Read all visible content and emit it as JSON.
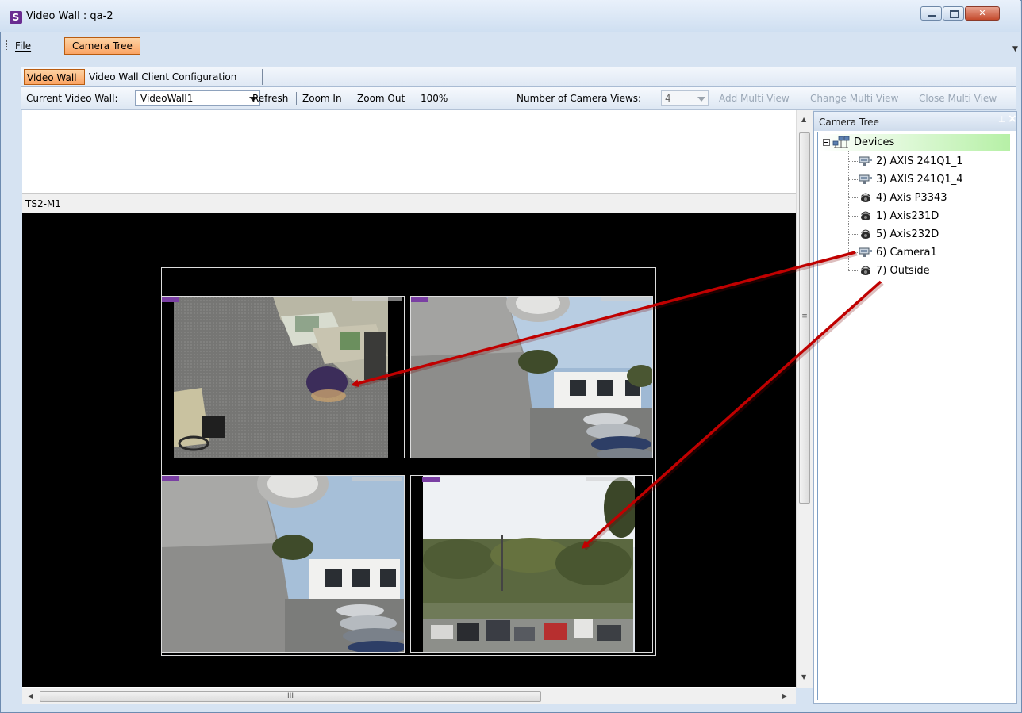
{
  "window": {
    "title": "Video Wall : qa-2",
    "app_icon_letter": "S"
  },
  "menu": {
    "file": "File",
    "camera_tree": "Camera Tree"
  },
  "tabs": [
    {
      "label": "Video Wall",
      "active": true
    },
    {
      "label": "Video Wall Client Configuration",
      "active": false
    }
  ],
  "toolbar": {
    "current_wall_label": "Current Video Wall:",
    "current_wall_value": "VideoWall1",
    "refresh": "Refresh",
    "zoom_in": "Zoom In",
    "zoom_out": "Zoom Out",
    "zoom_level": "100%",
    "num_views_label": "Number of Camera Views:",
    "num_views_value": "4",
    "add_multi_view": "Add Multi View",
    "change_multi_view": "Change Multi View",
    "close_multi_view": "Close Multi View"
  },
  "wall": {
    "monitor_label": "TS2-M1",
    "hscroll_grip": "III",
    "vscroll_grip": "≡"
  },
  "camera_tree": {
    "title": "Camera Tree",
    "pin_glyph": "⊥",
    "close_glyph": "×",
    "root": "Devices",
    "items": [
      {
        "label": "2) AXIS 241Q1_1",
        "icon": "video-server-icon"
      },
      {
        "label": "3) AXIS 241Q1_4",
        "icon": "video-server-icon"
      },
      {
        "label": "4) Axis P3343",
        "icon": "dome-camera-icon"
      },
      {
        "label": "1) Axis231D",
        "icon": "dome-camera-icon"
      },
      {
        "label": "5) Axis232D",
        "icon": "dome-camera-icon"
      },
      {
        "label": "6) Camera1",
        "icon": "video-server-icon"
      },
      {
        "label": "7) Outside",
        "icon": "dome-camera-icon"
      }
    ]
  },
  "colors": {
    "active_orange": "#fba464",
    "devices_highlight": "#b6f0a6",
    "annotation_arrow": "#c00000"
  }
}
